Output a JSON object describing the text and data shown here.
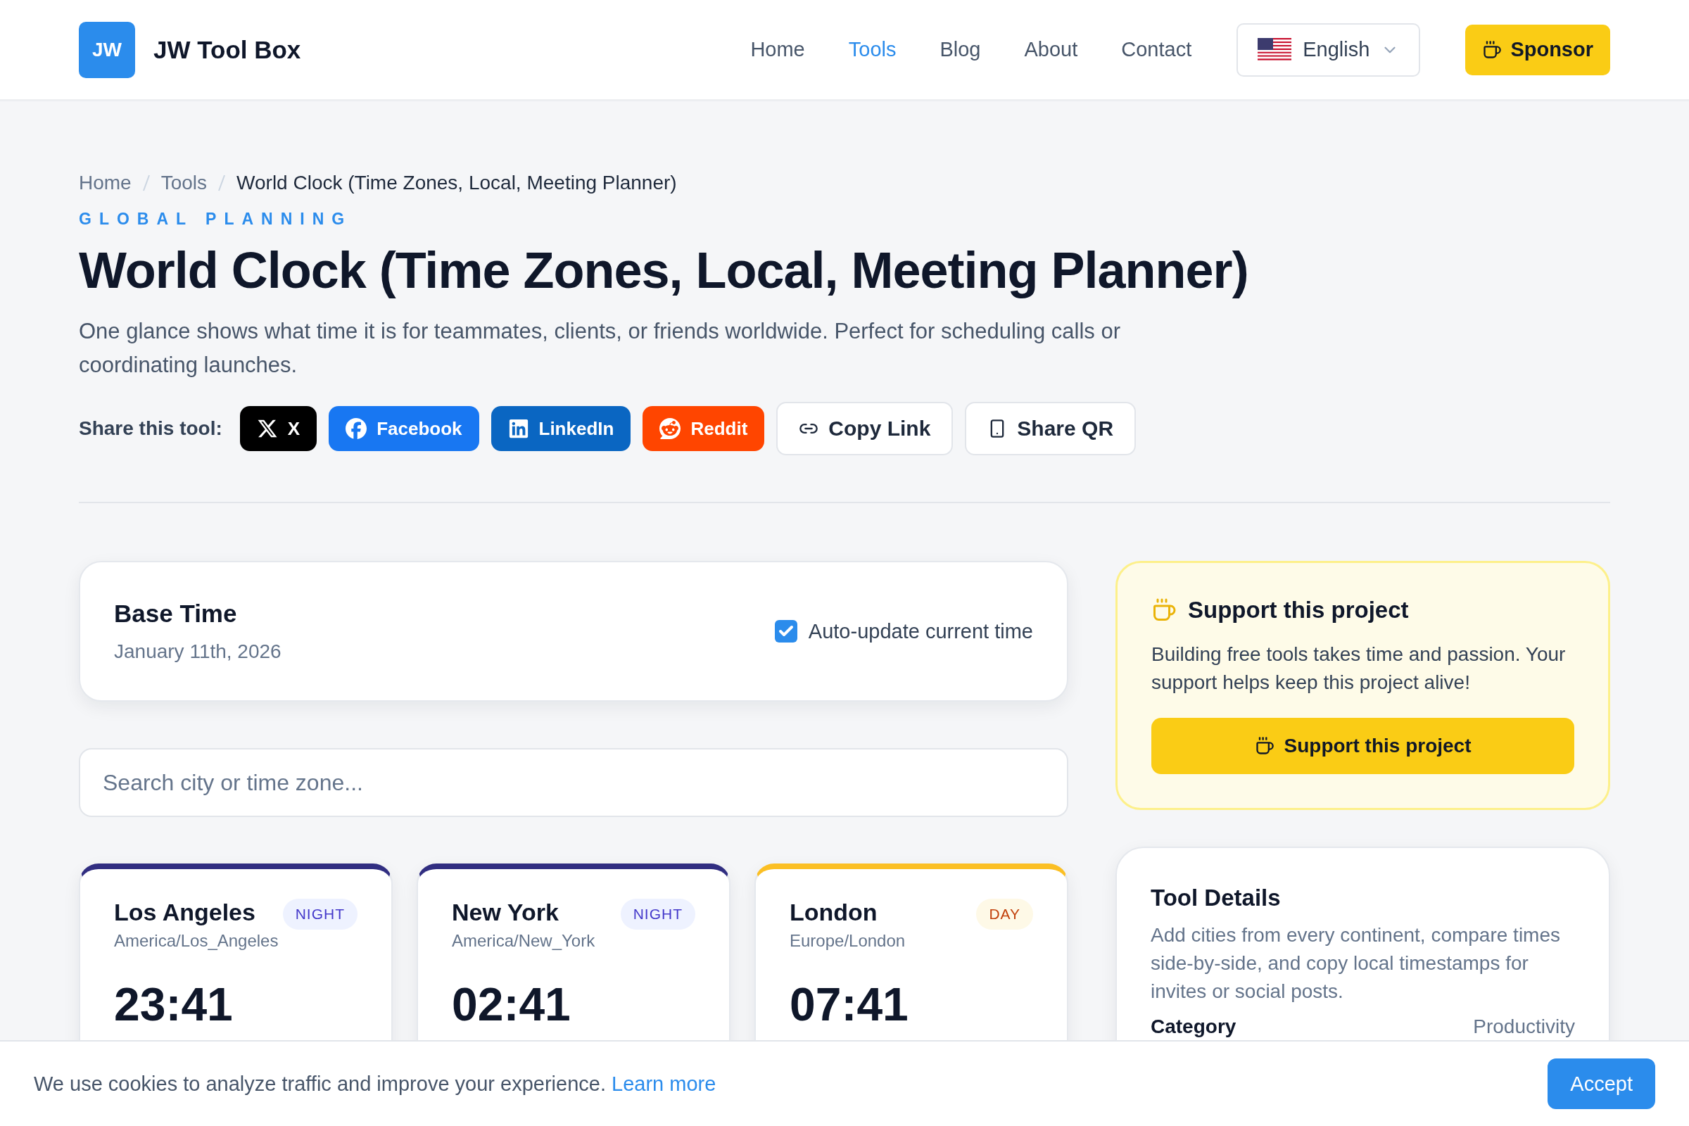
{
  "header": {
    "logo_mark": "JW",
    "brand": "JW Tool Box",
    "nav": [
      {
        "label": "Home",
        "selected": false
      },
      {
        "label": "Tools",
        "selected": true
      },
      {
        "label": "Blog",
        "selected": false
      },
      {
        "label": "About",
        "selected": false
      },
      {
        "label": "Contact",
        "selected": false
      }
    ],
    "language": "English",
    "sponsor": "Sponsor"
  },
  "breadcrumb": [
    "Home",
    "Tools",
    "World Clock (Time Zones, Local, Meeting Planner)"
  ],
  "eyebrow": "GLOBAL PLANNING",
  "title": "World Clock (Time Zones, Local, Meeting Planner)",
  "description": "One glance shows what time it is for teammates, clients, or friends worldwide. Perfect for scheduling calls or coordinating launches.",
  "share": {
    "label": "Share this tool:",
    "buttons": [
      {
        "kind": "x",
        "label": "X"
      },
      {
        "kind": "facebook",
        "label": "Facebook"
      },
      {
        "kind": "linkedin",
        "label": "LinkedIn"
      },
      {
        "kind": "reddit",
        "label": "Reddit"
      },
      {
        "kind": "copy",
        "label": "Copy Link"
      },
      {
        "kind": "qr",
        "label": "Share QR"
      }
    ]
  },
  "base_time": {
    "title": "Base Time",
    "date": "January 11th, 2026",
    "auto_update": {
      "label": "Auto-update current time",
      "checked": true
    }
  },
  "search": {
    "placeholder": "Search city or time zone..."
  },
  "cities": [
    {
      "name": "Los Angeles",
      "zone": "America/Los_Angeles",
      "kind": "night",
      "badge": "NIGHT",
      "time": "23:41"
    },
    {
      "name": "New York",
      "zone": "America/New_York",
      "kind": "night",
      "badge": "NIGHT",
      "time": "02:41"
    },
    {
      "name": "London",
      "zone": "Europe/London",
      "kind": "day",
      "badge": "DAY",
      "time": "07:41"
    }
  ],
  "support": {
    "title": "Support this project",
    "text": "Building free tools takes time and passion. Your support helps keep this project alive!",
    "button": "Support this project"
  },
  "tool_details": {
    "title": "Tool Details",
    "text": "Add cities from every continent, compare times side-by-side, and copy local timestamps for invites or social posts.",
    "rows": [
      {
        "label": "Category",
        "value": "Productivity"
      }
    ]
  },
  "cookie": {
    "text": "We use cookies to analyze traffic and improve your experience.",
    "link": "Learn more",
    "button": "Accept"
  }
}
